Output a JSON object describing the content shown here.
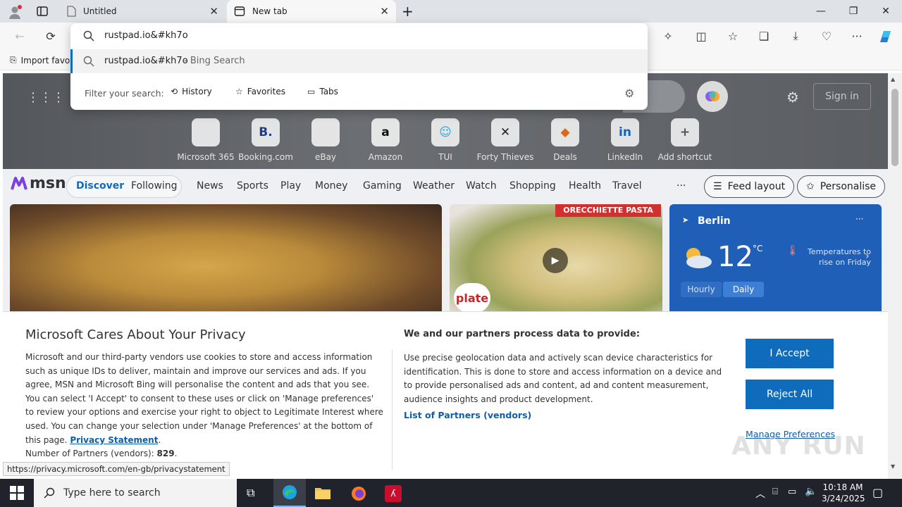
{
  "browser": {
    "tabs": [
      {
        "label": "Untitled"
      },
      {
        "label": "New tab"
      }
    ],
    "new_tab": "+",
    "fav_import": "Import favo"
  },
  "omnibox": {
    "query": "rustpad.io&#kh7o",
    "suggestion": "rustpad.io&#kh7o",
    "suggestion_suffix": " - Bing Search",
    "filter_label": "Filter your search:",
    "filters": [
      "History",
      "Favorites",
      "Tabs"
    ]
  },
  "newtab": {
    "sign_in": "Sign in",
    "shortcuts": [
      {
        "label": "Microsoft 365",
        "glyph": "",
        "color": "#7b4ad6"
      },
      {
        "label": "Booking.com",
        "glyph": "B.",
        "color": "#1f3c8f"
      },
      {
        "label": "eBay",
        "glyph": "",
        "color": "#333"
      },
      {
        "label": "Amazon",
        "glyph": "a",
        "color": "#111"
      },
      {
        "label": "TUI",
        "glyph": "☺",
        "color": "#2aa3e0"
      },
      {
        "label": "Forty Thieves",
        "glyph": "✕",
        "color": "#222"
      },
      {
        "label": "Deals",
        "glyph": "◆",
        "color": "#d9691c"
      },
      {
        "label": "LinkedIn",
        "glyph": "in",
        "color": "#0a66c2"
      },
      {
        "label": "Add shortcut",
        "glyph": "+",
        "color": "#555"
      }
    ],
    "msn_logo": "msn",
    "nav_pill": [
      "Discover",
      "Following"
    ],
    "nav": [
      "News",
      "Sports",
      "Play",
      "Money",
      "Gaming",
      "Weather",
      "Watch",
      "Shopping",
      "Health",
      "Travel"
    ],
    "more": "···",
    "feed_layout": "Feed layout",
    "personalise": "Personalise",
    "card2_banner": "ORECCHIETTE PASTA",
    "card2_tag": "plate",
    "weather": {
      "city": "Berlin",
      "temp": "12",
      "unit": "°C",
      "note": "Temperatures to rise on Friday",
      "tab_hourly": "Hourly",
      "tab_daily": "Daily",
      "more": "···"
    }
  },
  "privacy": {
    "title": "Microsoft Cares About Your Privacy",
    "body": "Microsoft and our third-party vendors use cookies to store and access information such as unique IDs to deliver, maintain and improve our services and ads. If you agree, MSN and Microsoft Bing will personalise the content and ads that you see. You can select 'I Accept' to consent to these uses or click on 'Manage preferences' to review your options and exercise your right to object to Legitimate Interest where used.  You can change your selection under 'Manage Preferences' at the bottom of this page.",
    "privacy_link": "Privacy Statement",
    "period": ".",
    "partners_label": "Number of Partners (vendors): ",
    "partners_count": "829",
    "partners_end": ".",
    "right_title": "We and our partners process data to provide:",
    "right_body": "Use precise geolocation data and actively scan device characteristics for identification. This is done to store and access information on a device and to provide personalised ads and content, ad and content measurement, audience insights and product development.",
    "partners_link": "List of Partners (vendors)",
    "accept": "I Accept",
    "reject": "Reject All",
    "manage": "Manage Preferences"
  },
  "status_url": "https://privacy.microsoft.com/en-gb/privacystatement",
  "watermark": "ANY RUN",
  "taskbar": {
    "search_placeholder": "Type here to search",
    "time": "10:18 AM",
    "date": "3/24/2025"
  }
}
